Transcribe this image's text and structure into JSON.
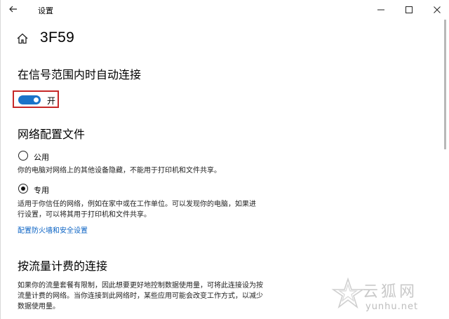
{
  "window": {
    "title": "设置",
    "controls": [
      "minimize-icon",
      "maximize-icon",
      "close-icon"
    ]
  },
  "header": {
    "title": "3F59",
    "home_icon": "home-icon"
  },
  "auto_connect": {
    "heading": "在信号范围内时自动连接",
    "toggle_state": "开",
    "toggle_on": true,
    "accent_color": "#1a73c9"
  },
  "profile": {
    "heading": "网络配置文件",
    "options": [
      {
        "label": "公用",
        "selected": false,
        "description": "你的电脑对网络上的其他设备隐藏，不能用于打印机和文件共享。"
      },
      {
        "label": "专用",
        "selected": true,
        "description": "适用于你信任的网络，例如在家中或在工作单位。可以发现你的电脑，如果进行设置，可以将其用于打印机和文件共享。"
      }
    ],
    "firewall_link": "配置防火墙和安全设置"
  },
  "metered": {
    "heading": "按流量计费的连接",
    "description": "如果你的流量套餐有限制，因此想要更好地控制数据使用量，可将此连接设为按流量计费的网络。当你连接到此网络时，某些应用可能会改变工作方式，以减少数据使用量。"
  },
  "watermark": {
    "text": "云狐网",
    "url": "yunhu.net"
  }
}
